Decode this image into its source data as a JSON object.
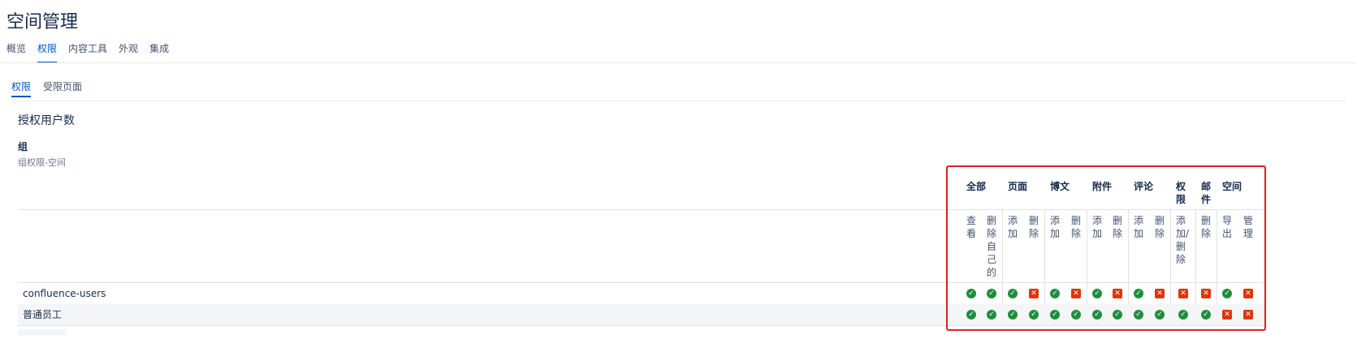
{
  "page": {
    "title": "空间管理"
  },
  "top_tabs": [
    {
      "label": "概览",
      "active": false
    },
    {
      "label": "权限",
      "active": true
    },
    {
      "label": "内容工具",
      "active": false
    },
    {
      "label": "外观",
      "active": false
    },
    {
      "label": "集成",
      "active": false
    }
  ],
  "sub_tabs": [
    {
      "label": "权限",
      "active": true
    },
    {
      "label": "受限页面",
      "active": false
    }
  ],
  "section": {
    "title": "授权用户数",
    "group_heading": "组",
    "group_sub": "组权限-空间"
  },
  "permissions": {
    "categories": [
      "全部",
      "页面",
      "博文",
      "附件",
      "评论",
      "权限",
      "邮件",
      "空间"
    ],
    "actions": [
      "查看",
      "删除自己的",
      "添加",
      "删除",
      "添加",
      "删除",
      "添加",
      "删除",
      "添加",
      "删除",
      "添加/删除",
      "删除",
      "导出",
      "管理"
    ],
    "rows": [
      {
        "name": "confluence-users",
        "values": [
          "yes",
          "yes",
          "yes",
          "no",
          "yes",
          "no",
          "yes",
          "no",
          "yes",
          "no",
          "no",
          "no",
          "yes",
          "no"
        ]
      },
      {
        "name": "普通员工",
        "values": [
          "yes",
          "yes",
          "yes",
          "yes",
          "yes",
          "yes",
          "yes",
          "yes",
          "yes",
          "yes",
          "yes",
          "yes",
          "no",
          "no"
        ]
      }
    ]
  },
  "colors": {
    "accent": "#0052cc",
    "allowed": "#1e8e3e",
    "denied": "#de350b",
    "highlight": "#e02020"
  },
  "icons": {
    "allowed": "check-circle-icon",
    "denied": "cross-square-icon"
  }
}
